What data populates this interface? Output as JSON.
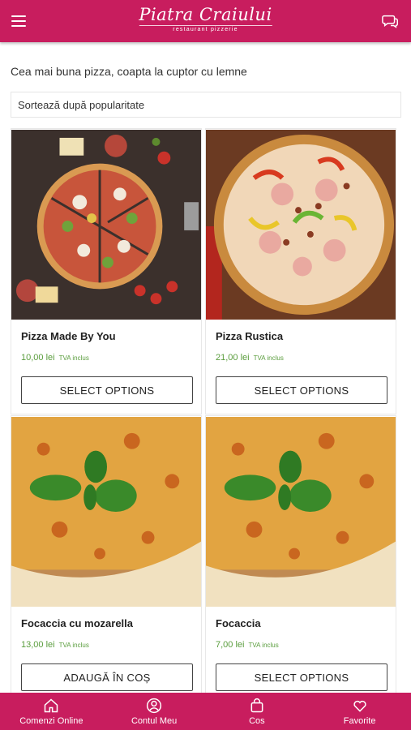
{
  "header": {
    "logo_text": "Piatra Craiului",
    "logo_tagline": "restaurant  pizzerie"
  },
  "intro_text": "Cea mai buna pizza, coapta la cuptor cu lemne",
  "sort_select": {
    "value": "Sortează după popularitate"
  },
  "products": [
    {
      "title": "Pizza Made By You",
      "price": "10,00 lei",
      "tax_note": "TVA inclus",
      "button_label": "SELECT OPTIONS",
      "image": "pizza-made-by-you-image"
    },
    {
      "title": "Pizza Rustica",
      "price": "21,00 lei",
      "tax_note": "TVA inclus",
      "button_label": "SELECT OPTIONS",
      "image": "pizza-rustica-image"
    },
    {
      "title": "Focaccia cu mozarella",
      "price": "13,00 lei",
      "tax_note": "TVA inclus",
      "button_label": "ADAUGĂ ÎN COȘ",
      "image": "focaccia-mozarella-image"
    },
    {
      "title": "Focaccia",
      "price": "7,00 lei",
      "tax_note": "TVA inclus",
      "button_label": "SELECT OPTIONS",
      "image": "focaccia-image"
    }
  ],
  "bottom_nav": [
    {
      "label": "Comenzi Online",
      "icon": "home-icon"
    },
    {
      "label": "Contul Meu",
      "icon": "account-icon"
    },
    {
      "label": "Cos",
      "icon": "bag-icon"
    },
    {
      "label": "Favorite",
      "icon": "heart-icon"
    }
  ],
  "colors": {
    "brand": "#c81d5e",
    "price": "#5a9d3d"
  }
}
